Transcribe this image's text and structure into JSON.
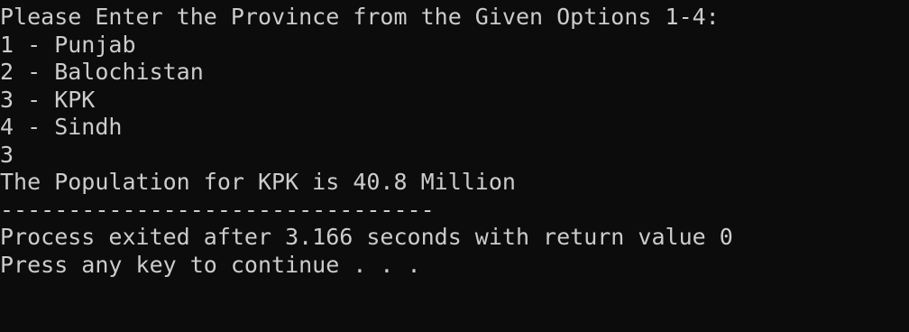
{
  "console": {
    "lines": [
      "Please Enter the Province from the Given Options 1-4:",
      "1 - Punjab",
      "2 - Balochistan",
      "3 - KPK",
      "4 - Sindh",
      "3",
      "The Population for KPK is 40.8 Million",
      "--------------------------------",
      "Process exited after 3.166 seconds with return value 0",
      "Press any key to continue . . ."
    ],
    "colors": {
      "background": "#0c0c0c",
      "text": "#cccccc"
    }
  }
}
